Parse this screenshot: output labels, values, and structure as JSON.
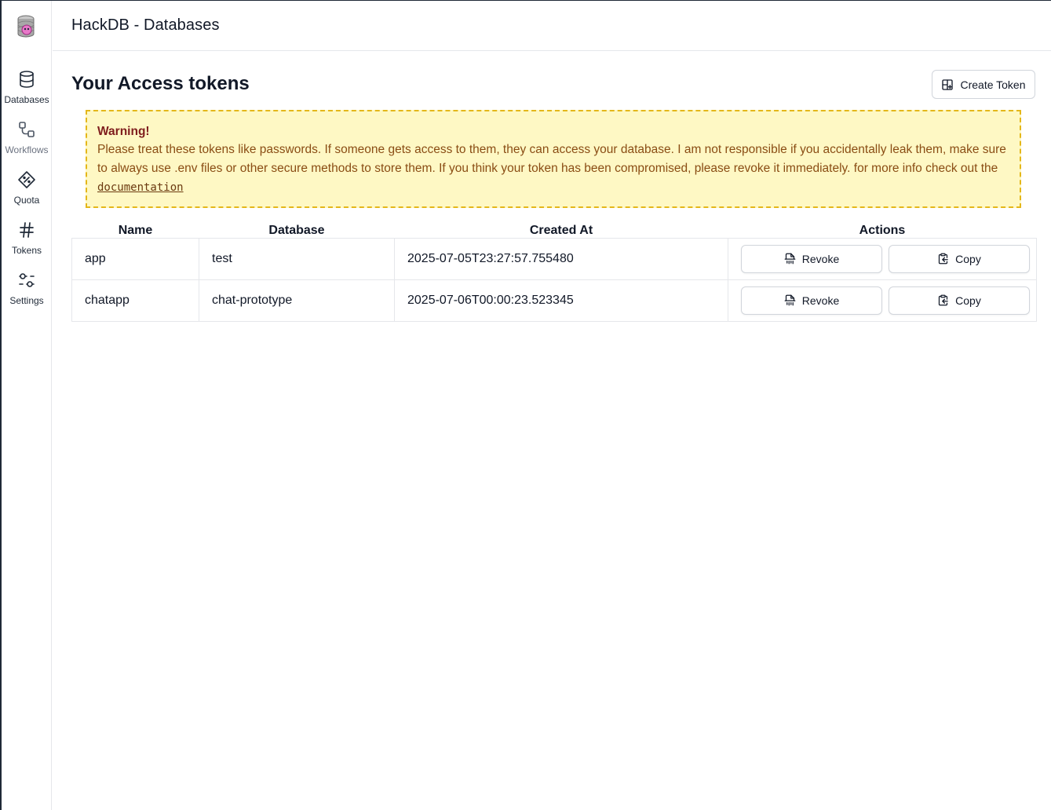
{
  "app": {
    "title": "HackDB - Databases",
    "logo_icon": "database-logo-icon"
  },
  "sidebar": {
    "items": [
      {
        "label": "Databases",
        "icon": "database-icon"
      },
      {
        "label": "Workflows",
        "icon": "workflow-icon"
      },
      {
        "label": "Quota",
        "icon": "quota-icon"
      },
      {
        "label": "Tokens",
        "icon": "hash-icon"
      },
      {
        "label": "Settings",
        "icon": "sliders-icon"
      }
    ]
  },
  "main": {
    "title": "Your Access tokens",
    "create_button": "Create Token"
  },
  "warning": {
    "title": "Warning!",
    "body": "Please treat these tokens like passwords. If someone gets access to them, they can access your database. I am not responsible if you accidentally leak them, make sure to always use .env files or other secure methods to store them. If you think your token has been compromised, please revoke it immediately. for more info check out the ",
    "link": "documentation"
  },
  "table": {
    "headers": [
      "Name",
      "Database",
      "Created At",
      "Actions"
    ],
    "rows": [
      {
        "name": "app",
        "database": "test",
        "created_at": "2025-07-05T23:27:57.755480",
        "revoke": "Revoke",
        "copy": "Copy"
      },
      {
        "name": "chatapp",
        "database": "chat-prototype",
        "created_at": "2025-07-06T00:00:23.523345",
        "revoke": "Revoke",
        "copy": "Copy"
      }
    ]
  },
  "colors": {
    "warning_bg": "#fef8c4",
    "warning_border": "#e4b71a",
    "warning_title": "#7f1d1d",
    "warning_text": "#8a4d14"
  }
}
